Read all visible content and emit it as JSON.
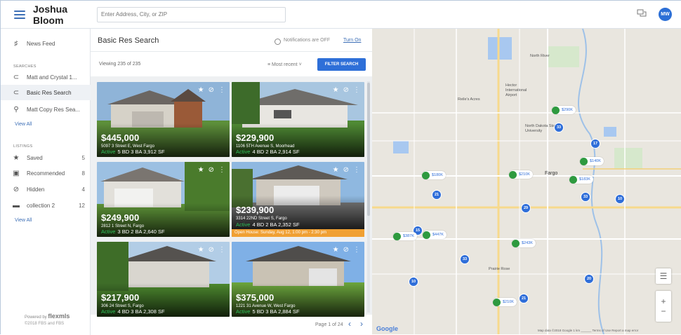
{
  "header": {
    "brand": "Joshua Bloom",
    "search_placeholder": "Enter Address, City, or ZIP",
    "avatar_initials": "MW"
  },
  "sidebar": {
    "news_feed": "News Feed",
    "searches_heading": "SEARCHES",
    "searches": [
      {
        "label": "Matt and Crystal 1...",
        "icon": "magnet-icon"
      },
      {
        "label": "Basic Res Search",
        "icon": "magnet-icon"
      },
      {
        "label": "Matt Copy Res Sea...",
        "icon": "search-icon"
      }
    ],
    "searches_view_all": "View All",
    "listings_heading": "LISTINGS",
    "listings": [
      {
        "label": "Saved",
        "count": "5",
        "icon": "star-icon"
      },
      {
        "label": "Recommended",
        "count": "8",
        "icon": "briefcase-icon"
      },
      {
        "label": "Hidden",
        "count": "4",
        "icon": "block-icon"
      },
      {
        "label": "collection 2",
        "count": "12",
        "icon": "folder-icon"
      }
    ],
    "listings_view_all": "View All",
    "powered_by": "Powered by",
    "powered_brand": "flexmls",
    "copyright": "©2018 FBS and FBS"
  },
  "list": {
    "title": "Basic Res Search",
    "notifications_text": "Notifications are OFF",
    "notifications_link": "Turn On",
    "viewing": "Viewing 235 of 235",
    "sort_label": "Most recent",
    "filter_button": "FILTER SEARCH",
    "pager": "Page 1 of 24",
    "cards": [
      {
        "price": "$445,000",
        "address": "5097 3 Street E, West Fargo",
        "status": "Active",
        "details": "5 BD  3 BA  3,912 SF"
      },
      {
        "price": "$229,900",
        "address": "1106 5TH Avenue S, Moorhead",
        "status": "Active",
        "details": "4 BD  2 BA  2,914 SF"
      },
      {
        "price": "$249,900",
        "address": "2812 1 Street N, Fargo",
        "status": "Active",
        "details": "3 BD  2 BA  2,640 SF"
      },
      {
        "price": "$239,900",
        "address": "3314 22ND Street S, Fargo",
        "status": "Active",
        "details": "4 BD  2 BA  2,352 SF",
        "open_house": "Open House: Sunday, Aug 12, 1:00 pm - 2:30 pm"
      },
      {
        "price": "$217,900",
        "address": "306 24 Street S, Fargo",
        "status": "Active",
        "details": "4 BD  3 BA  2,308 SF"
      },
      {
        "price": "$375,000",
        "address": "1221 31 Avenue W, West Fargo",
        "status": "Active",
        "details": "5 BD  3 BA  2,884 SF"
      }
    ]
  },
  "map": {
    "labels": {
      "north_river": "North River",
      "hector": "Hector International Airport",
      "ndsu": "North Dakota State University",
      "fargo": "Fargo",
      "prairie_rose": "Prairie Rose",
      "reile_acres": "Reile's Acres"
    },
    "clusters": [
      "33",
      "17",
      "21",
      "29",
      "33",
      "10",
      "15",
      "33",
      "10",
      "20",
      "21"
    ],
    "houses": [
      "$290K",
      "$140K",
      "$180K",
      "$210K",
      "$183K",
      "$387K",
      "$447K",
      "$243K",
      "$210K"
    ],
    "google": "Google",
    "footer": "Map data ©2018 Google   1 km ______   Terms of Use   Report a map error"
  }
}
